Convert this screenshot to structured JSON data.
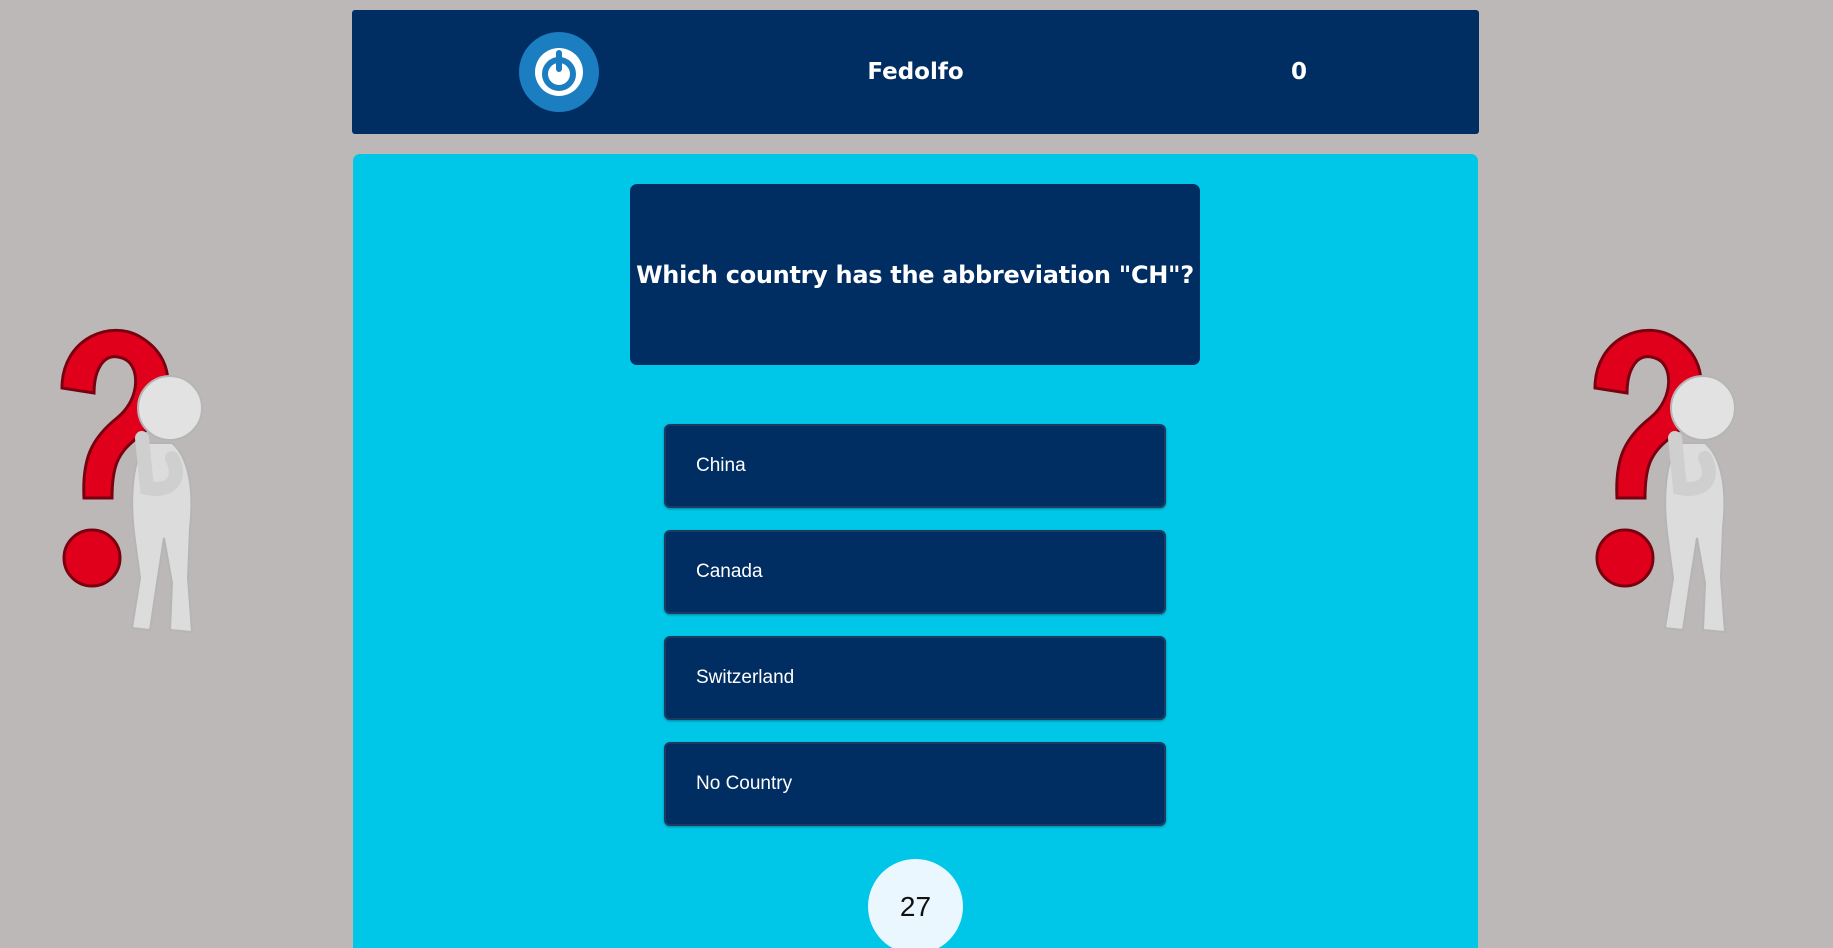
{
  "header": {
    "power_icon": "power-icon",
    "player_name": "Fedolfo",
    "score": "0"
  },
  "quiz": {
    "question": "Which country has the abbreviation \"CH\"?",
    "answers": [
      {
        "label": "China"
      },
      {
        "label": "Canada"
      },
      {
        "label": "Switzerland"
      },
      {
        "label": "No Country"
      }
    ],
    "timer": "27"
  },
  "decorations": {
    "left_icon": "thinking-figure-question-mark",
    "right_icon": "thinking-figure-question-mark"
  },
  "colors": {
    "page_background": "#bdb8b8",
    "header_background": "#002d62",
    "panel_background": "#00c6e8",
    "button_background": "#002d62",
    "power_button": "#1a7ec0",
    "question_mark_red": "#e0001b",
    "timer_background": "#eaf7ff"
  }
}
